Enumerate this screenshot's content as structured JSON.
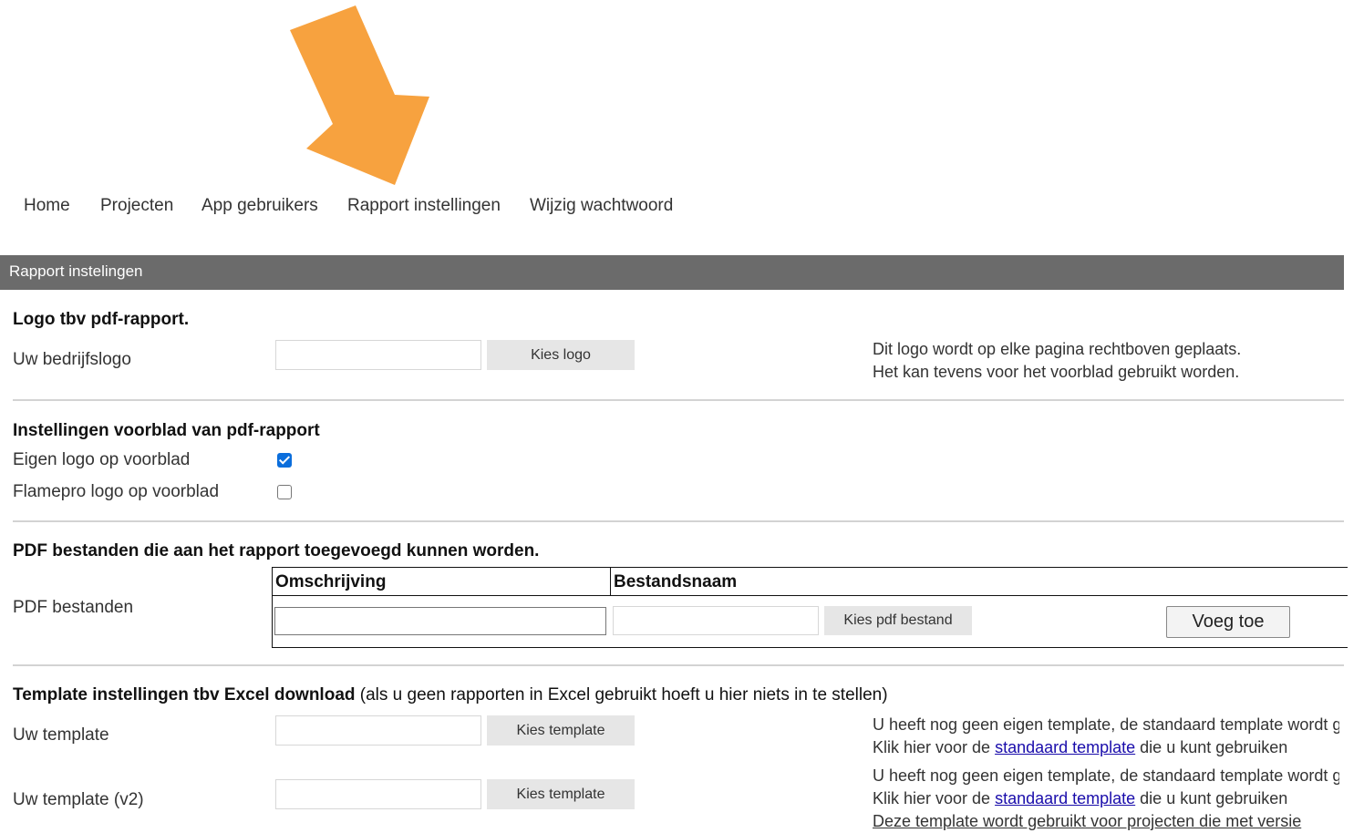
{
  "nav": {
    "items": [
      "Home",
      "Projecten",
      "App gebruikers",
      "Rapport instellingen",
      "Wijzig wachtwoord"
    ]
  },
  "header_bar": {
    "title": "Rapport instelingen"
  },
  "logo_section": {
    "heading": "Logo tbv pdf-rapport.",
    "label": "Uw bedrijfslogo",
    "button": "Kies logo",
    "info_line1": "Dit logo wordt op elke pagina rechtboven geplaats.",
    "info_line2": "Het kan tevens voor het voorblad gebruikt worden."
  },
  "cover_section": {
    "heading": "Instellingen voorblad van pdf-rapport",
    "own_logo_label": "Eigen logo op voorblad",
    "own_logo_checked": true,
    "flamepro_label": "Flamepro logo op voorblad",
    "flamepro_checked": false
  },
  "pdf_section": {
    "heading": "PDF bestanden die aan het rapport toegevoegd kunnen worden.",
    "label": "PDF bestanden",
    "col_description": "Omschrijving",
    "col_filename": "Bestandsnaam",
    "choose_button": "Kies pdf bestand",
    "add_button": "Voeg toe"
  },
  "template_section": {
    "heading_bold": "Template instellingen tbv Excel download",
    "heading_note": " (als u geen rapporten in Excel gebruikt hoeft u hier niets in te stellen)",
    "template1_label": "Uw template",
    "template1_button": "Kies template",
    "template1_info_line1": "U heeft nog geen eigen template, de standaard template wordt gebruikt.",
    "template1_info_prefix": "Klik hier voor de ",
    "template1_info_link": "standaard template",
    "template1_info_suffix": " die u kunt gebruiken",
    "template2_label": "Uw template (v2)",
    "template2_button": "Kies template",
    "template2_info_line1": "U heeft nog geen eigen template, de standaard template wordt gebruikt.",
    "template2_info_prefix": "Klik hier voor de ",
    "template2_info_link": "standaard template",
    "template2_info_suffix": " die u kunt gebruiken",
    "template2_info_line3": "Deze template wordt gebruikt voor projecten die met versie"
  },
  "colors": {
    "annotation_arrow": "#f7a23f",
    "header_bar": "#6b6b6b",
    "link": "#1a0dab",
    "checkbox_checked": "#0b6edc"
  }
}
